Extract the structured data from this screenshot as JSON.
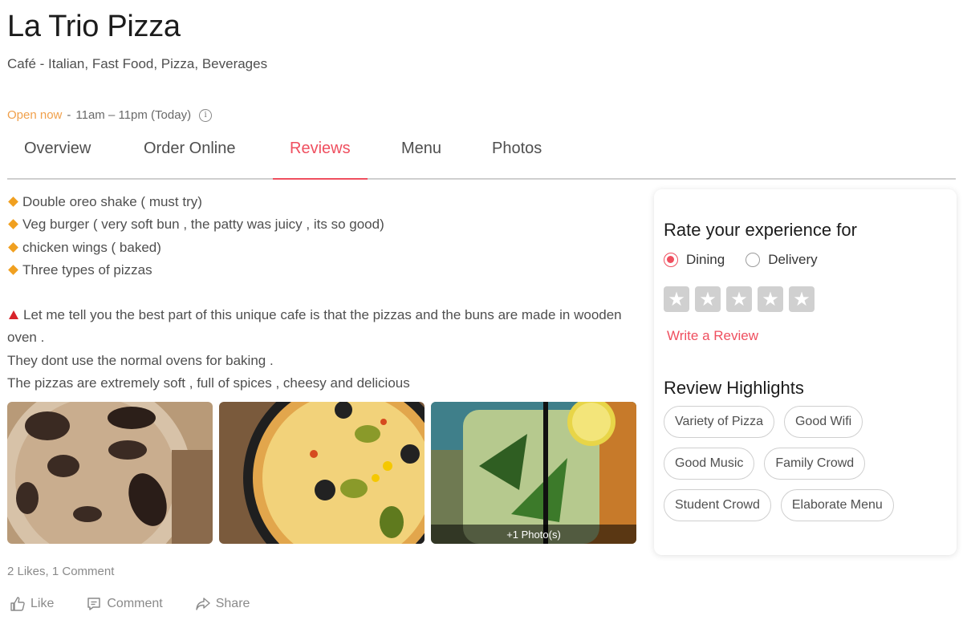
{
  "restaurant": {
    "name": "La Trio Pizza",
    "cuisines": "Café - Italian, Fast Food, Pizza, Beverages",
    "status": "Open now",
    "separator": "-",
    "hours": "11am – 11pm (Today)"
  },
  "tabs": [
    {
      "label": "Overview",
      "active": false
    },
    {
      "label": "Order Online",
      "active": false
    },
    {
      "label": "Reviews",
      "active": true
    },
    {
      "label": "Menu",
      "active": false
    },
    {
      "label": "Photos",
      "active": false
    }
  ],
  "review": {
    "items": [
      "Double oreo shake ( must try)",
      "Veg burger ( very soft bun , the patty was juicy , its so good)",
      "chicken wings ( baked)",
      "Three types of pizzas"
    ],
    "paragraph_1": "Let me tell you the best part of this unique cafe is that the pizzas and the buns are made in wooden oven .",
    "paragraph_2": "They dont use the normal ovens for baking .",
    "paragraph_3": "The pizzas are extremely soft , full of spices , cheesy and delicious",
    "photos": [
      {
        "subject": "oreo-shake"
      },
      {
        "subject": "pizza"
      },
      {
        "subject": "mojito"
      }
    ],
    "more_photos": "+1 Photo(s)",
    "engagement": "2 Likes, 1 Comment",
    "actions": {
      "like": "Like",
      "comment": "Comment",
      "share": "Share"
    }
  },
  "rating_card": {
    "title": "Rate your experience for",
    "options": [
      {
        "label": "Dining",
        "selected": true
      },
      {
        "label": "Delivery",
        "selected": false
      }
    ],
    "stars": 5,
    "write_review": "Write a Review",
    "highlights_title": "Review Highlights",
    "highlights": [
      "Variety of Pizza",
      "Good Wifi",
      "Good Music",
      "Family Crowd",
      "Student Crowd",
      "Elaborate Menu"
    ]
  },
  "colors": {
    "accent": "#ef4f5f",
    "open": "#f0a04b",
    "text": "#4f4f4f"
  }
}
